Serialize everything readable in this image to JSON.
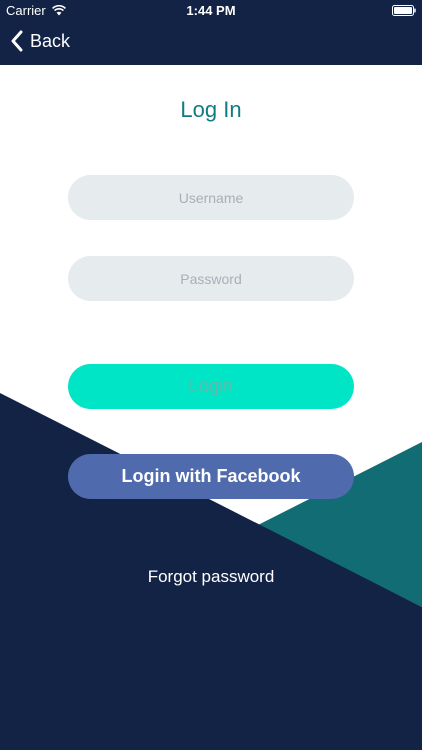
{
  "status_bar": {
    "carrier": "Carrier",
    "time": "1:44 PM",
    "wifi_icon": "wifi-icon",
    "battery_icon": "battery-icon"
  },
  "nav": {
    "back_label": "Back",
    "back_icon": "chevron-left-icon"
  },
  "page": {
    "title": "Log In"
  },
  "form": {
    "username_placeholder": "Username",
    "username_value": "",
    "password_placeholder": "Password",
    "password_value": ""
  },
  "actions": {
    "login_label": "Login",
    "facebook_label": "Login with Facebook",
    "forgot_label": "Forgot password"
  },
  "colors": {
    "nav_background": "#132345",
    "title": "#137a85",
    "login_button": "#00e5c5",
    "facebook_button": "#4f6aad",
    "teal_shape": "#126c73",
    "field_background": "#e6ebee"
  }
}
